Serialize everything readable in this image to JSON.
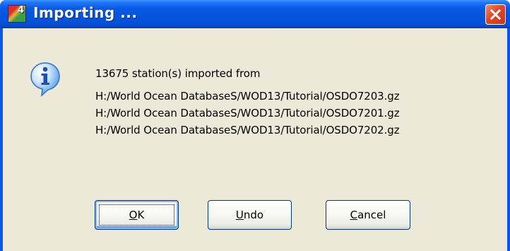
{
  "window": {
    "title": "Importing ...",
    "app_icon_number": "4"
  },
  "message": {
    "summary": "13675 station(s) imported from",
    "files": [
      "H:/World Ocean DatabaseS/WOD13/Tutorial/OSDO7203.gz",
      "H:/World Ocean DatabaseS/WOD13/Tutorial/OSDO7201.gz",
      "H:/World Ocean DatabaseS/WOD13/Tutorial/OSDO7202.gz"
    ]
  },
  "buttons": {
    "ok": {
      "mnemonic": "O",
      "rest": "K"
    },
    "undo": {
      "mnemonic": "U",
      "rest": "ndo"
    },
    "cancel": {
      "mnemonic": "C",
      "rest": "ancel"
    }
  },
  "icons": {
    "app": "odv-app-icon",
    "info": "information-icon",
    "close": "close-icon"
  },
  "colors": {
    "titlebar": "#0454dd",
    "close_button": "#e0462a",
    "dialog_background": "#ece9d8",
    "info_icon": "#2f7fd6"
  }
}
